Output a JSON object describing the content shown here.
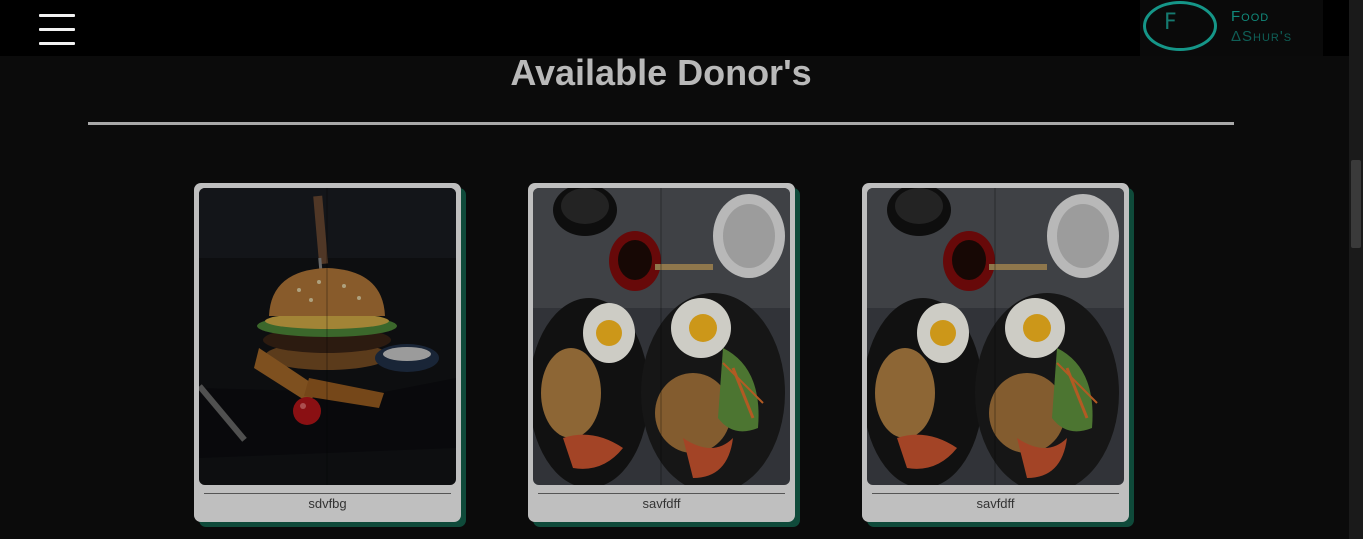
{
  "header": {
    "menu_icon": "hamburger-menu-icon",
    "logo": {
      "line1": "Food",
      "line2": "ΔShur's",
      "mark": "F",
      "accent": "#159688"
    }
  },
  "main": {
    "title": "Available Donor's",
    "cards": [
      {
        "image": "burger-photo",
        "name": "sdvfbg"
      },
      {
        "image": "breakfast-plate-photo",
        "name": "savfdff"
      },
      {
        "image": "breakfast-plate-photo",
        "name": "savfdff"
      }
    ]
  },
  "colors": {
    "background": "#0b0b0b",
    "card": "#bfbfbf",
    "card_shadow": "#0f4a3a"
  }
}
